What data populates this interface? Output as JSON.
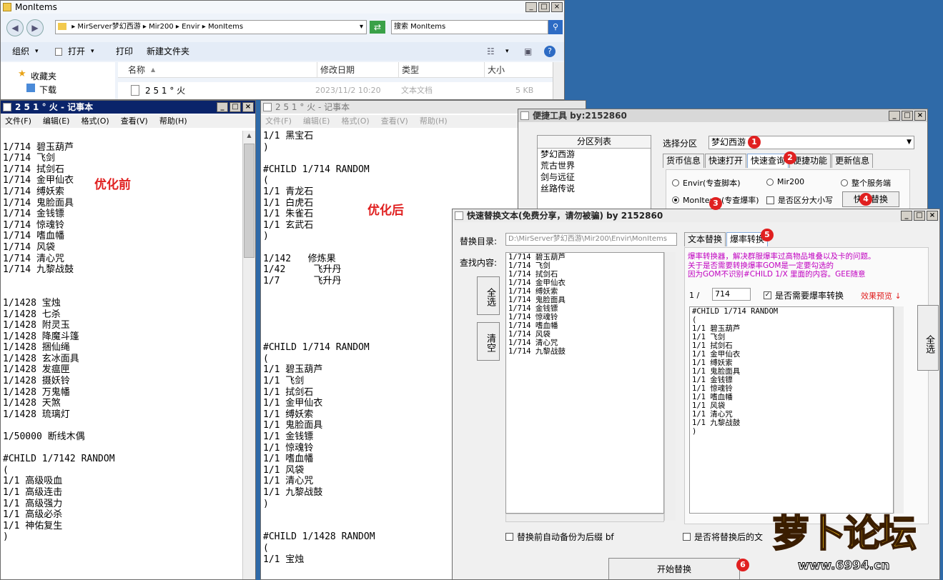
{
  "explorer": {
    "title": "MonItems",
    "path": [
      "MirServer梦幻西游",
      "Mir200",
      "Envir",
      "MonItems"
    ],
    "search_placeholder": "搜索 MonItems",
    "toolbar": {
      "organize": "组织",
      "open": "打开",
      "print": "打印",
      "new_folder": "新建文件夹"
    },
    "nav": {
      "favorites": "收藏夹",
      "downloads": "下载"
    },
    "columns": {
      "name": "名称",
      "modified": "修改日期",
      "type": "类型",
      "size": "大小"
    },
    "file": {
      "name": "2 5 1 ° 火",
      "modified": "2023/11/2 10:20",
      "type": "文本文档",
      "size": "5 KB"
    }
  },
  "notepad_before": {
    "title": "2 5 1 ° 火 - 记事本",
    "menu": [
      "文件(F)",
      "编辑(E)",
      "格式(O)",
      "查看(V)",
      "帮助(H)"
    ],
    "label": "优化前",
    "text": "\n1/714 碧玉葫芦\n1/714 飞剑\n1/714 拭剑石\n1/714 金甲仙衣\n1/714 缚妖索\n1/714 鬼脸面具\n1/714 金钱镖\n1/714 惊魂铃\n1/714 嗜血幡\n1/714 风袋\n1/714 清心咒\n1/714 九黎战鼓\n\n\n1/1428 宝烛\n1/1428 七杀\n1/1428 附灵玉\n1/1428 降魔斗篷\n1/1428 捆仙绳\n1/1428 玄冰面具\n1/1428 发瘟匣\n1/1428 摄妖铃\n1/1428 万鬼幡\n1/1428 天煞\n1/1428 琉璃灯\n\n1/50000 断线木偶\n\n#CHILD 1/7142 RANDOM\n(\n1/1 高级吸血\n1/1 高级连击\n1/1 高级强力\n1/1 高级必杀\n1/1 神佑复生\n)"
  },
  "notepad_after": {
    "title": "2 5 1 ° 火 - 记事本",
    "menu": [
      "文件(F)",
      "编辑(E)",
      "格式(O)",
      "查看(V)",
      "帮助(H)"
    ],
    "label": "优化后",
    "text": "1/1 黑宝石\n)\n\n#CHILD 1/714 RANDOM\n(\n1/1 青龙石\n1/1 白虎石\n1/1 朱雀石\n1/1 玄武石\n)\n\n1/142   修炼果\n1/42     飞升丹\n1/7      飞升丹\n\n\n\n\n\n#CHILD 1/714 RANDOM\n(\n1/1 碧玉葫芦\n1/1 飞剑\n1/1 拭剑石\n1/1 金甲仙衣\n1/1 缚妖索\n1/1 鬼脸面具\n1/1 金钱镖\n1/1 惊魂铃\n1/1 嗜血幡\n1/1 风袋\n1/1 清心咒\n1/1 九黎战鼓\n)\n\n\n#CHILD 1/1428 RANDOM\n(\n1/1 宝烛"
  },
  "tool": {
    "title": "便捷工具   by:2152860",
    "partition_header": "分区列表",
    "partitions": [
      "梦幻西游",
      "荒古世界",
      "剑与远征",
      "丝路传说"
    ],
    "select_label": "选择分区",
    "selected_partition": "梦幻西游",
    "tabs": [
      "货币信息",
      "快速打开",
      "快速查询",
      "便捷功能",
      "更新信息"
    ],
    "radios": {
      "envir": "Envir(专查脚本)",
      "mir200": "Mir200",
      "server": "整个服务端",
      "monitems": "MonItems(专查爆率)"
    },
    "case_label": "是否区分大小写",
    "replace_button": "快速替换"
  },
  "replace": {
    "title": "快速替换文本(免费分享，请勿被骗)       by 2152860",
    "dir_label": "替换目录:",
    "dir_value": "D:\\MirServer梦幻西游\\Mir200\\Envir\\MonItems",
    "find_label": "查找内容:",
    "select_all": "全选",
    "clear": "清空",
    "find_text": "1/714 碧玉葫芦\n1/714 飞剑\n1/714 拭剑石\n1/714 金甲仙衣\n1/714 缚妖索\n1/714 鬼脸面具\n1/714 金钱镖\n1/714 惊魂铃\n1/714 嗜血幡\n1/714 风袋\n1/714 清心咒\n1/714 九黎战鼓",
    "tabs": [
      "文本替换",
      "爆率转换"
    ],
    "info": "爆率转换器，解决群服爆率过高物品堆叠以及卡的问题。\n关于是否需要转换爆率GOM是一定要勾选的\n因为GOM不识别#CHILD 1/X 里面的内容。GEE随意",
    "rate_prefix": "1 /",
    "rate_value": "714",
    "convert_label": "是否需要爆率转换",
    "preview_label": "效果预览 ↓",
    "preview_text": "#CHILD 1/714 RANDOM\n(\n1/1 碧玉葫芦\n1/1 飞剑\n1/1 拭剑石\n1/1 金甲仙衣\n1/1 缚妖索\n1/1 鬼脸面具\n1/1 金钱镖\n1/1 惊魂铃\n1/1 嗜血幡\n1/1 风袋\n1/1 清心咒\n1/1 九黎战鼓\n)",
    "select_all_right": "全选",
    "backup_label": "替换前自动备份为后缀 bf",
    "save_label": "是否将替换后的文",
    "start_button": "开始替换"
  },
  "markers": [
    "1",
    "2",
    "3",
    "4",
    "5",
    "6"
  ],
  "watermark": {
    "logo": "萝卜论坛",
    "url": "www.6994.cn"
  },
  "colors": {
    "accent_red": "#e02020",
    "title_active": "#0a246a",
    "desktop": "#2f6aa8",
    "magenta_text": "#c000c0"
  }
}
